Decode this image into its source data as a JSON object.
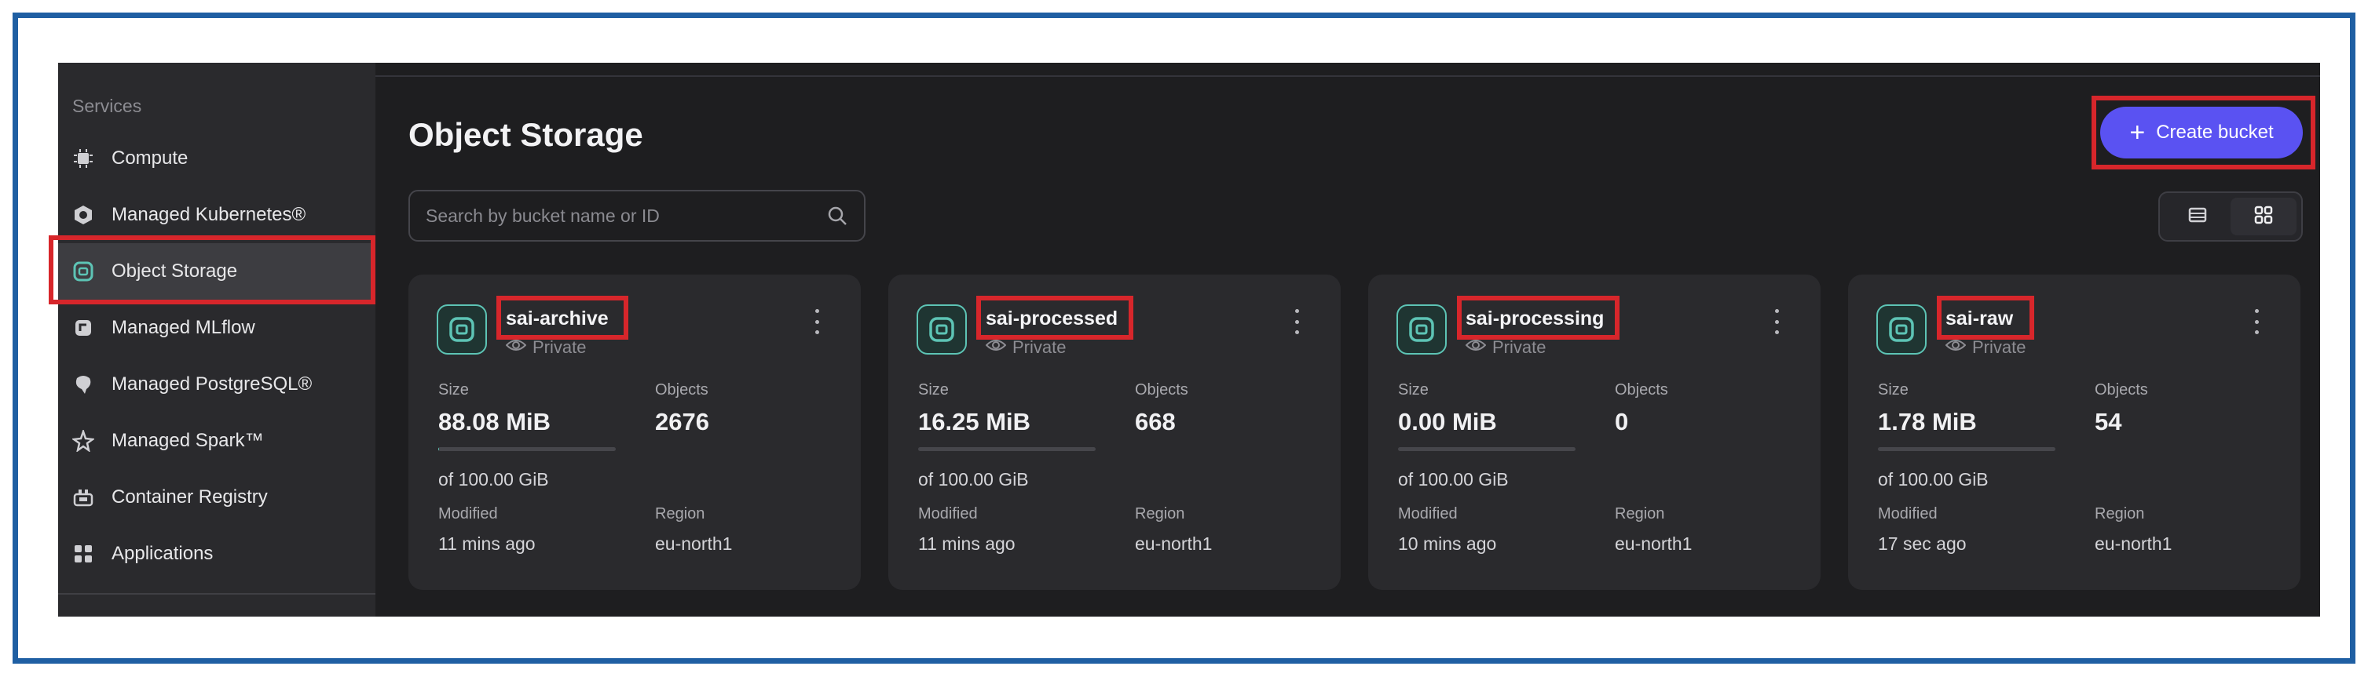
{
  "sidebar": {
    "section_title": "Services",
    "items": [
      {
        "label": "Compute",
        "icon": "chip-icon"
      },
      {
        "label": "Managed Kubernetes®",
        "icon": "kubernetes-icon"
      },
      {
        "label": "Object Storage",
        "icon": "storage-bucket-icon",
        "active": true
      },
      {
        "label": "Managed MLflow",
        "icon": "mlflow-icon"
      },
      {
        "label": "Managed PostgreSQL®",
        "icon": "postgresql-icon"
      },
      {
        "label": "Managed Spark™",
        "icon": "spark-icon"
      },
      {
        "label": "Container Registry",
        "icon": "container-registry-icon"
      },
      {
        "label": "Applications",
        "icon": "applications-grid-icon"
      }
    ]
  },
  "page": {
    "title": "Object Storage",
    "search_placeholder": "Search by bucket name or ID",
    "create_button_label": "Create bucket"
  },
  "labels": {
    "size": "Size",
    "objects": "Objects",
    "modified": "Modified",
    "region": "Region"
  },
  "buckets": [
    {
      "name": "sai-archive",
      "visibility": "Private",
      "size": "88.08 MiB",
      "quota": "of 100.00 GiB",
      "usage_fraction": 0.0009,
      "objects": "2676",
      "modified": "11 mins ago",
      "region": "eu-north1"
    },
    {
      "name": "sai-processed",
      "visibility": "Private",
      "size": "16.25 MiB",
      "quota": "of 100.00 GiB",
      "usage_fraction": 0.0002,
      "objects": "668",
      "modified": "11 mins ago",
      "region": "eu-north1"
    },
    {
      "name": "sai-processing",
      "visibility": "Private",
      "size": "0.00 MiB",
      "quota": "of 100.00 GiB",
      "usage_fraction": 0,
      "objects": "0",
      "modified": "10 mins ago",
      "region": "eu-north1"
    },
    {
      "name": "sai-raw",
      "visibility": "Private",
      "size": "1.78 MiB",
      "quota": "of 100.00 GiB",
      "usage_fraction": 2e-05,
      "objects": "54",
      "modified": "17 sec ago",
      "region": "eu-north1"
    }
  ],
  "colors": {
    "accent": "#5a52f2",
    "highlight": "#d7262b",
    "frame": "#1f5fa3",
    "bucket_icon": "#5dc4b5"
  }
}
